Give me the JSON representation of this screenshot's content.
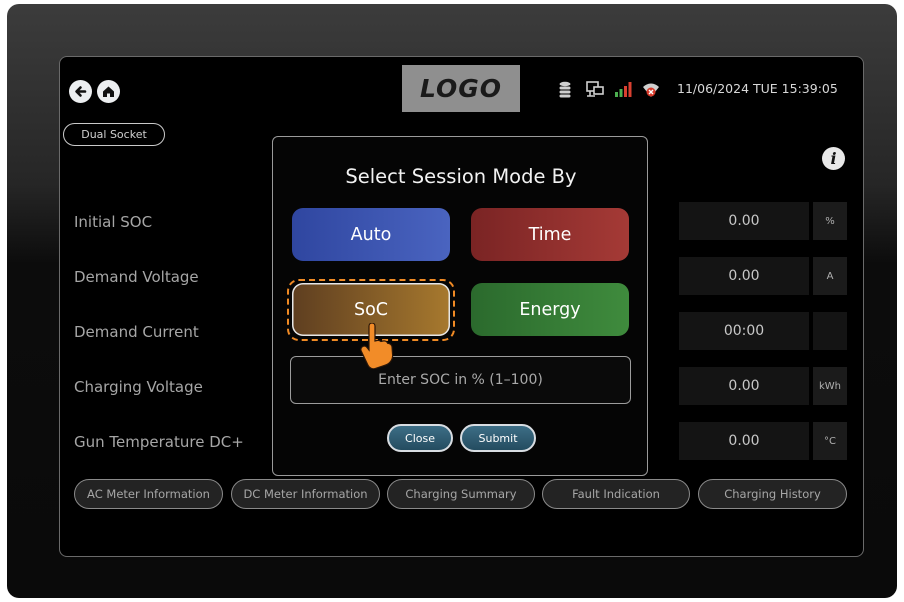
{
  "header": {
    "back_icon": "arrow-left-circle-icon",
    "home_icon": "home-circle-icon",
    "logo_text": "LOGO",
    "status_icons": [
      "database-icon",
      "network-icon",
      "signal-icon",
      "wifi-off-icon"
    ],
    "datetime": "11/06/2024 TUE 15:39:05",
    "info_icon": "info-icon"
  },
  "socket_badge": "Dual Socket",
  "parameters": [
    {
      "label": "Initial SOC",
      "value": "0.00",
      "unit": "%"
    },
    {
      "label": "Demand Voltage",
      "value": "0.00",
      "unit": "A"
    },
    {
      "label": "Demand Current",
      "value": "00:00",
      "unit": ""
    },
    {
      "label": "Charging Voltage",
      "value": "0.00",
      "unit": "kWh"
    },
    {
      "label": "Gun Temperature DC+",
      "value": "0.00",
      "unit": "°C"
    }
  ],
  "bottom_nav": [
    "AC Meter Information",
    "DC Meter Information",
    "Charging Summary",
    "Fault Indication",
    "Charging History"
  ],
  "modal": {
    "title": "Select Session Mode By",
    "modes": [
      {
        "label": "Auto",
        "color": "#3a4fa8"
      },
      {
        "label": "Time",
        "color": "#8e2e2e"
      },
      {
        "label": "SoC",
        "color": "#6e4a26",
        "selected": true
      },
      {
        "label": "Energy",
        "color": "#2f6e31"
      }
    ],
    "input_placeholder": "Enter SOC in % (1–100)",
    "close_label": "Close",
    "submit_label": "Submit"
  },
  "colors": {
    "highlight": "#f08a24",
    "cursor": "#f28c28"
  }
}
